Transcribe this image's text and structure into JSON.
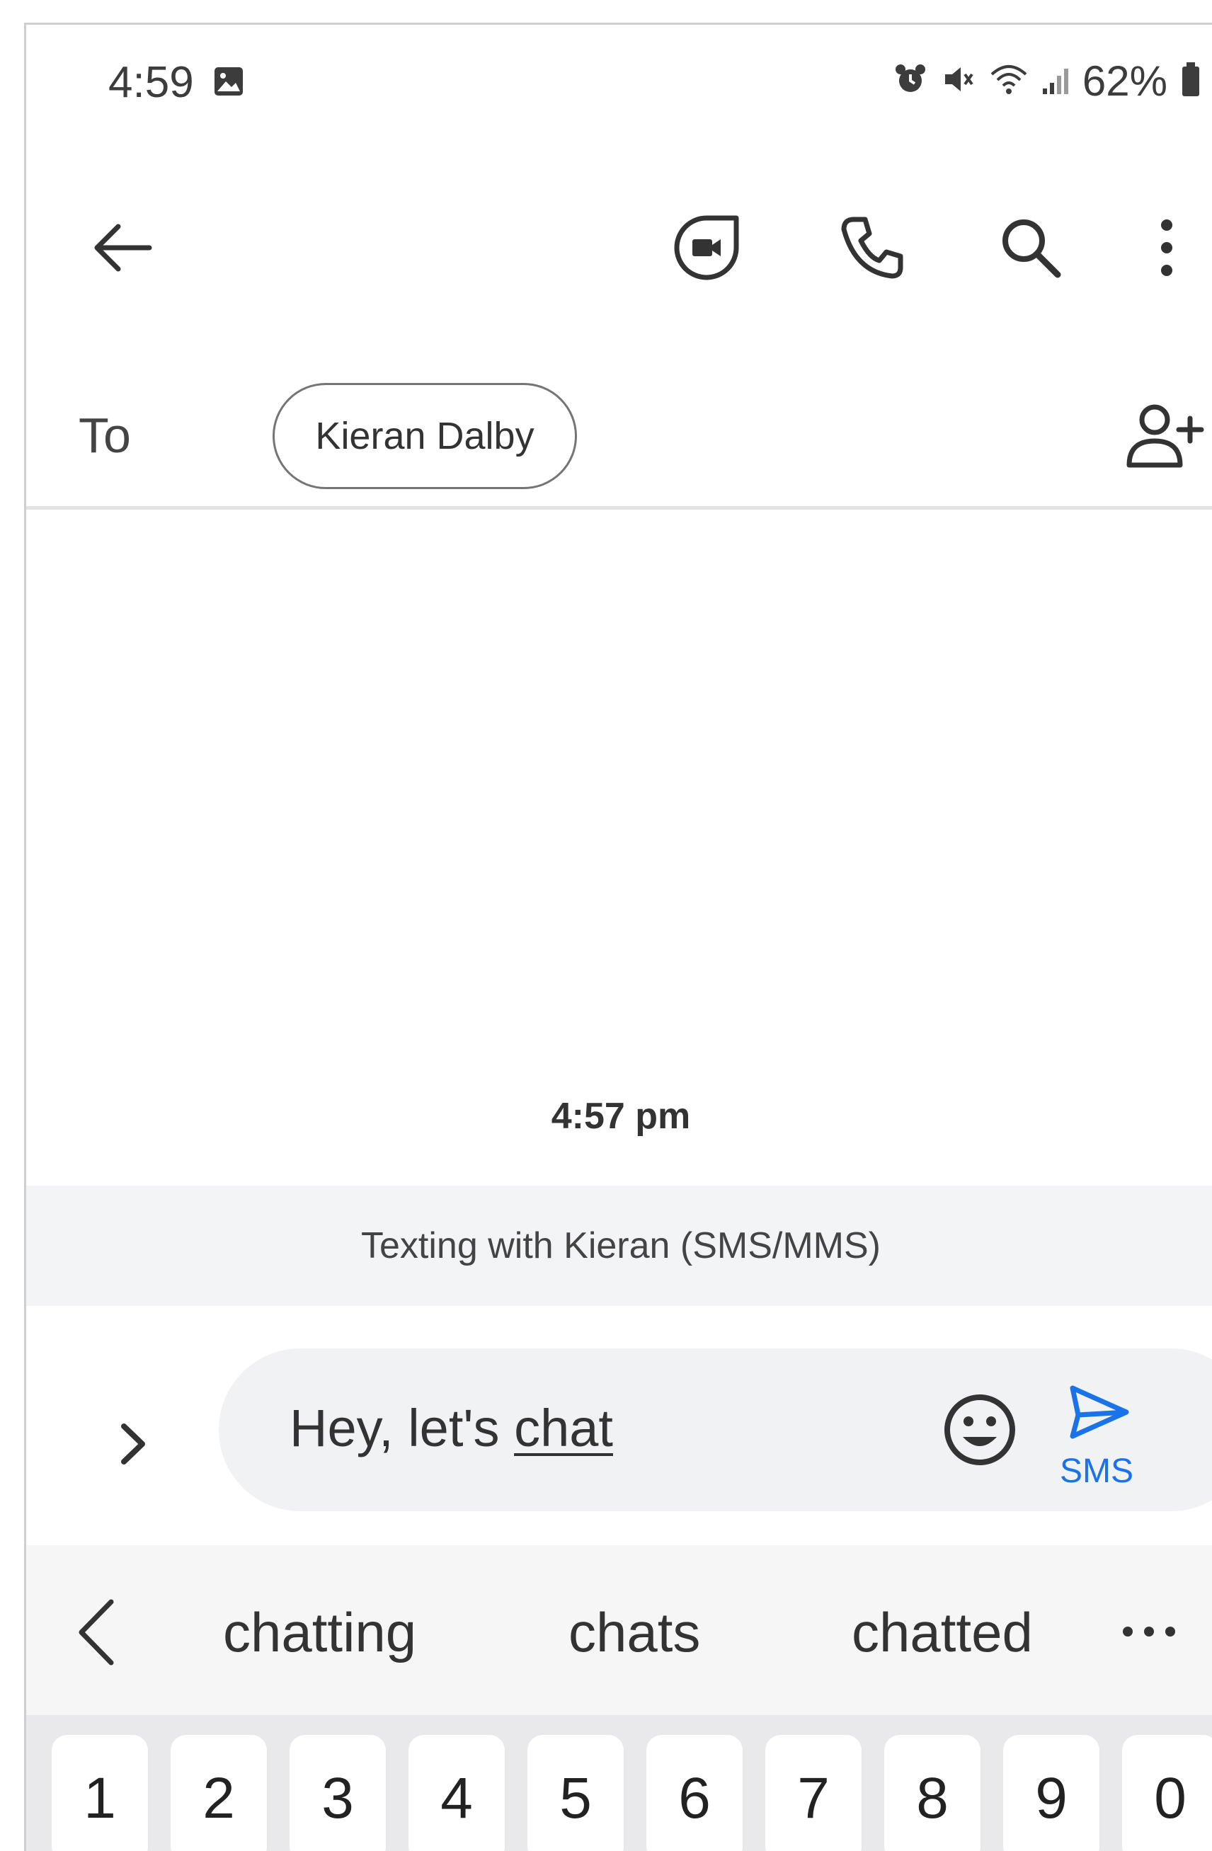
{
  "status_bar": {
    "time": "4:59",
    "battery": "62%"
  },
  "recipient": {
    "to_label": "To",
    "chip_name": "Kieran Dalby"
  },
  "conversation": {
    "timestamp": "4:57 pm",
    "mode_banner": "Texting with Kieran (SMS/MMS)"
  },
  "compose": {
    "text_prefix": "Hey, let's ",
    "text_current_word": "chat",
    "send_label": "SMS"
  },
  "suggestions": [
    "chatting",
    "chats",
    "chatted"
  ],
  "keyboard": {
    "number_row": [
      "1",
      "2",
      "3",
      "4",
      "5",
      "6",
      "7",
      "8",
      "9",
      "0"
    ]
  },
  "colors": {
    "accent": "#1a73e8",
    "compose_bg": "#f1f2f4",
    "banner_bg": "#f3f4f6",
    "keyboard_bg": "#e9e9eb"
  },
  "icons": {
    "status_left": "image-notification-icon",
    "status_right": [
      "alarm-icon",
      "mute-icon",
      "wifi-icon",
      "signal-icon",
      "battery-icon"
    ],
    "app_bar": [
      "back-arrow-icon",
      "video-call-icon",
      "phone-icon",
      "search-icon",
      "more-vert-icon"
    ],
    "add_person": "add-person-icon",
    "expand": "chevron-right-icon",
    "emoji": "emoji-icon",
    "send": "send-icon",
    "suggestion_back": "chevron-left-icon",
    "suggestion_more": "more-horiz-icon"
  }
}
